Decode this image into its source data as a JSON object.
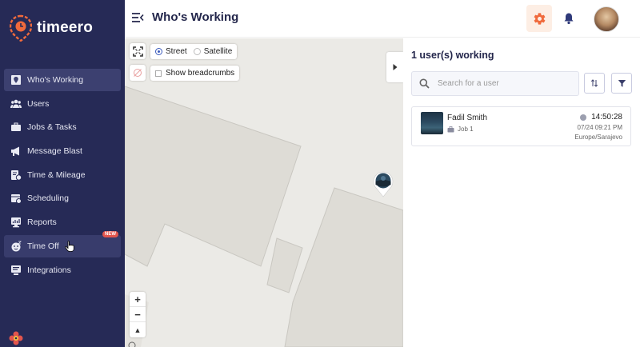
{
  "app": {
    "brand": "timeero"
  },
  "sidebar": {
    "items": [
      {
        "label": "Who's Working",
        "icon": "map-pin-icon",
        "active": true
      },
      {
        "label": "Users",
        "icon": "users-icon"
      },
      {
        "label": "Jobs & Tasks",
        "icon": "briefcase-icon"
      },
      {
        "label": "Message Blast",
        "icon": "megaphone-icon"
      },
      {
        "label": "Time & Mileage",
        "icon": "timesheet-icon"
      },
      {
        "label": "Scheduling",
        "icon": "calendar-icon"
      },
      {
        "label": "Reports",
        "icon": "reports-icon"
      },
      {
        "label": "Time Off",
        "icon": "beach-icon",
        "badge": "NEW",
        "hovered": true
      },
      {
        "label": "Integrations",
        "icon": "integrations-icon"
      }
    ]
  },
  "header": {
    "title": "Who's Working"
  },
  "map": {
    "layer_options": [
      "Street",
      "Satellite"
    ],
    "selected_layer": "Street",
    "breadcrumbs_label": "Show breadcrumbs",
    "breadcrumbs_checked": false,
    "zoom_in": "+",
    "zoom_out": "−",
    "compass": "▲"
  },
  "panel": {
    "title": "1 user(s) working",
    "search_placeholder": "Search for a user",
    "users": [
      {
        "name": "Fadil Smith",
        "job": "Job 1",
        "timer": "14:50:28",
        "start": "07/24 09:21 PM",
        "timezone": "Europe/Sarajevo"
      }
    ]
  },
  "colors": {
    "sidebar_bg": "#262a56",
    "accent_orange": "#f06a3c",
    "brand_navy": "#23264b",
    "badge_red": "#e2554d"
  }
}
